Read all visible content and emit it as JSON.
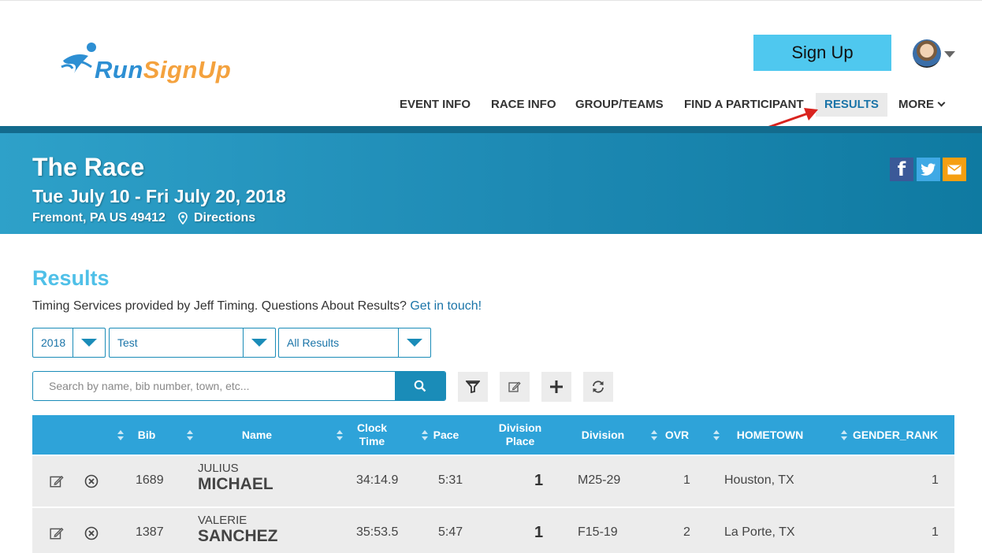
{
  "header": {
    "logo": {
      "run": "Run",
      "signup": "SignUp"
    },
    "signup_label": "Sign Up"
  },
  "nav": [
    {
      "label": "EVENT INFO"
    },
    {
      "label": "RACE INFO"
    },
    {
      "label": "GROUP/TEAMS"
    },
    {
      "label": "FIND A PARTICIPANT"
    },
    {
      "label": "RESULTS",
      "active": true
    },
    {
      "label": "MORE"
    }
  ],
  "banner": {
    "title": "The Race",
    "dates": "Tue July 10 - Fri July 20, 2018",
    "location": "Fremont, PA US 49412",
    "directions": "Directions"
  },
  "results": {
    "title": "Results",
    "timing_text": "Timing Services provided by Jeff Timing. Questions About Results?",
    "timing_link": "Get in touch!",
    "year_select": "2018",
    "event_select": "Test",
    "results_select": "All Results",
    "search_placeholder": "Search by name, bib number, town, etc..."
  },
  "table": {
    "columns": [
      "Bib",
      "Name",
      "Clock Time",
      "Pace",
      "Division Place",
      "Division",
      "OVR",
      "HOMETOWN",
      "GENDER_RANK"
    ],
    "rows": [
      {
        "bib": "1689",
        "first": "JULIUS",
        "last": "MICHAEL",
        "clock": "34:14.9",
        "pace": "5:31",
        "div_place": "1",
        "division": "M25-29",
        "ovr": "1",
        "hometown": "Houston, TX",
        "gender_rank": "1"
      },
      {
        "bib": "1387",
        "first": "VALERIE",
        "last": "SANCHEZ",
        "clock": "35:53.5",
        "pace": "5:47",
        "div_place": "1",
        "division": "F15-19",
        "ovr": "2",
        "hometown": "La Porte, TX",
        "gender_rank": "1"
      }
    ]
  },
  "colors": {
    "accent": "#2ea3d9",
    "signup": "#4fc8ef",
    "results_title": "#4fc0e8",
    "link": "#1a74a8"
  }
}
